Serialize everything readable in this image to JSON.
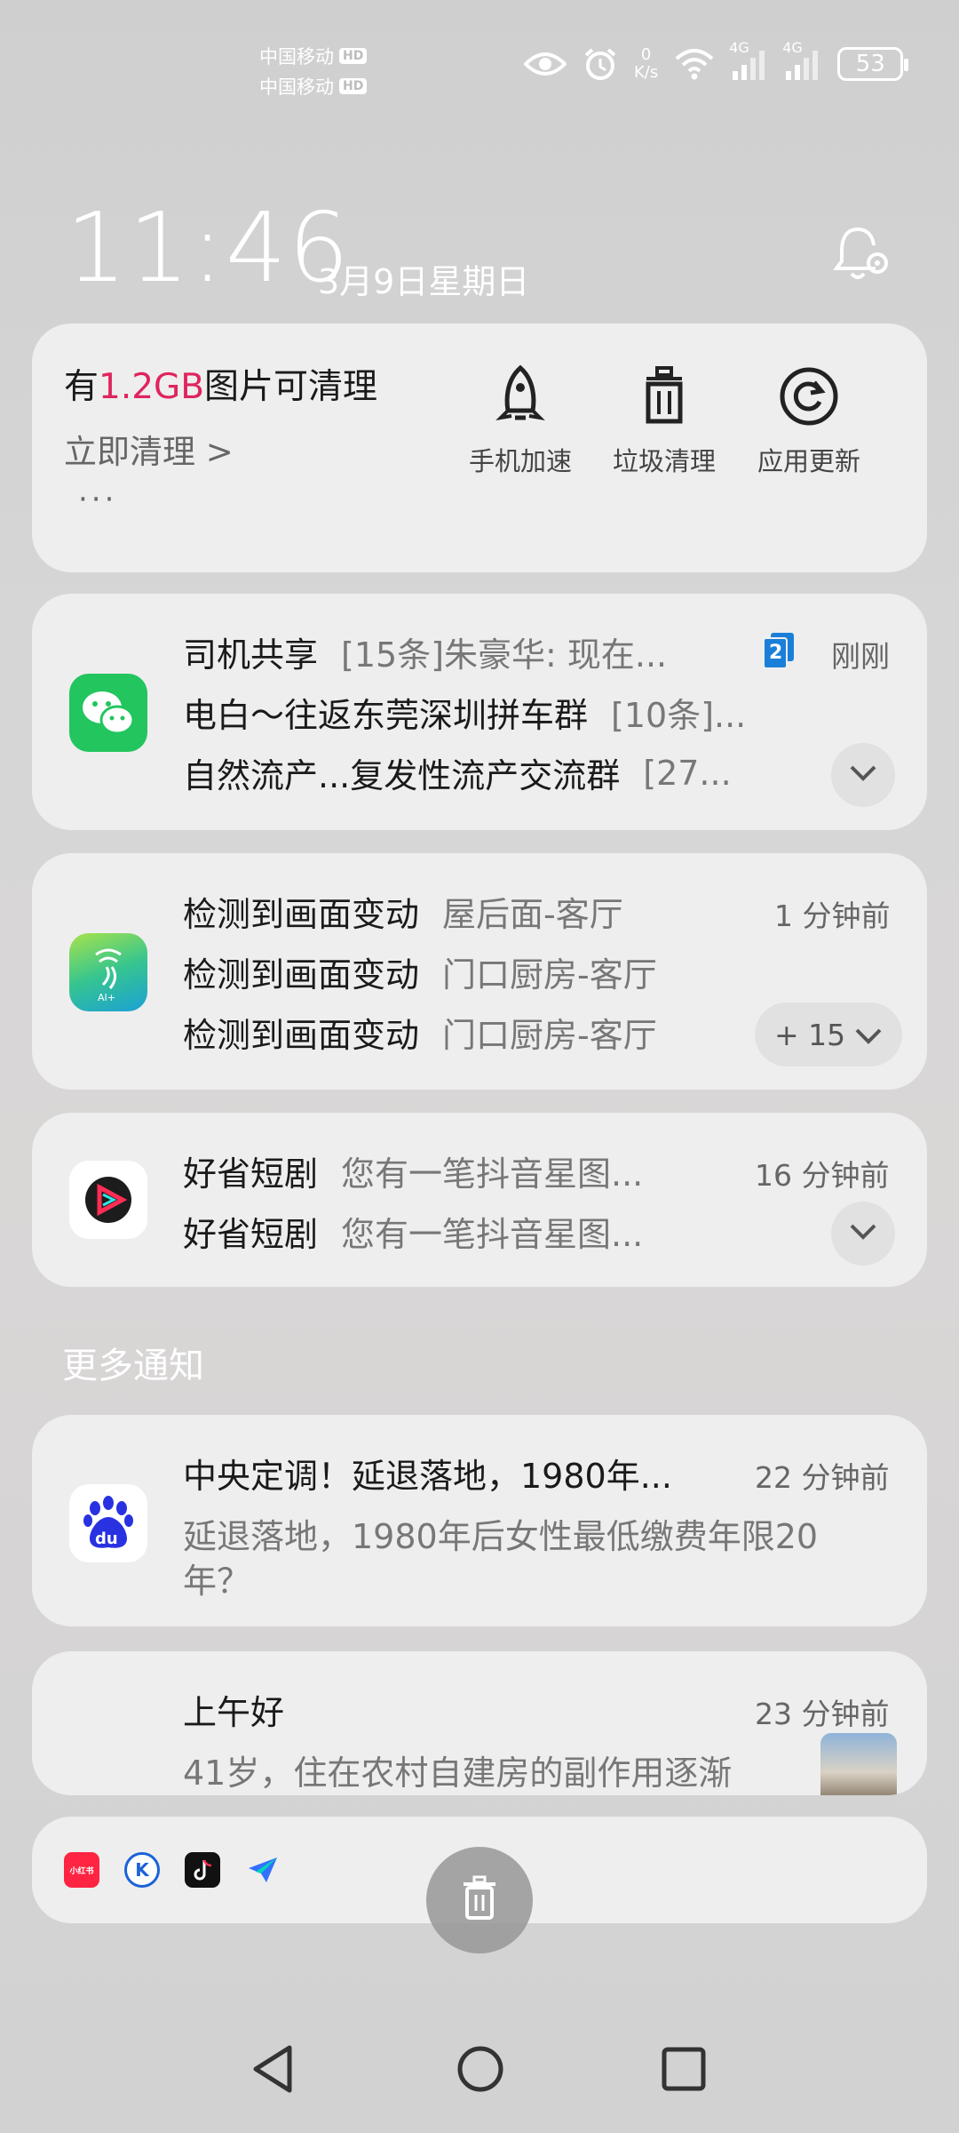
{
  "status_bar": {
    "carrier1": "中国移动",
    "carrier2": "中国移动",
    "hd_badge": "HD",
    "net_speed_value": "0",
    "net_speed_unit": "K/s",
    "signal1_type": "4G",
    "signal2_type": "4G",
    "battery": "53"
  },
  "lockscreen": {
    "time": "11:46",
    "date": "3月9日星期日"
  },
  "cleaner_card": {
    "prefix": "有",
    "size": "1.2GB",
    "suffix": "图片可清理",
    "action": "立即清理 >",
    "more": "···",
    "accent_color": "#e0245e",
    "tools": [
      {
        "label": "手机加速",
        "icon": "rocket-icon"
      },
      {
        "label": "垃圾清理",
        "icon": "trash-icon"
      },
      {
        "label": "应用更新",
        "icon": "refresh-icon"
      }
    ]
  },
  "notifications": [
    {
      "app_icon": "wechat-icon",
      "time": "刚刚",
      "badge": "2",
      "lines": [
        {
          "title": "司机共享",
          "text": "[15条]朱豪华: 现在..."
        },
        {
          "title": "电白～往返东莞深圳拼车群",
          "text": "[10条]..."
        },
        {
          "title": "自然流产...复发性流产交流群",
          "text": "[27..."
        }
      ]
    },
    {
      "app_icon": "camera-ai-icon",
      "time": "1 分钟前",
      "more_count": "+ 15",
      "lines": [
        {
          "title": "检测到画面变动",
          "text": "屋后面-客厅"
        },
        {
          "title": "检测到画面变动",
          "text": "门口厨房-客厅"
        },
        {
          "title": "检测到画面变动",
          "text": "门口厨房-客厅"
        }
      ]
    },
    {
      "app_icon": "video-play-icon",
      "time": "16 分钟前",
      "lines": [
        {
          "title": "好省短剧",
          "text": "您有一笔抖音星图..."
        },
        {
          "title": "好省短剧",
          "text": "您有一笔抖音星图..."
        }
      ]
    }
  ],
  "more_section": {
    "label": "更多通知",
    "items": [
      {
        "app_icon": "baidu-icon",
        "title": "中央定调！延退落地，1980年...",
        "time": "22 分钟前",
        "body1": "延退落地，1980年后女性最低缴费年限20",
        "body2": "年？"
      },
      {
        "title": "上午好",
        "time": "23 分钟前",
        "body1": "41岁，住在农村自建房的副作用逐渐"
      }
    ]
  },
  "dock": {
    "apps": [
      {
        "label": "小红书",
        "color": "#ff2442"
      },
      {
        "label": "K",
        "color": "#1a62d8"
      },
      {
        "label": "douyin-icon",
        "color": "#111111"
      },
      {
        "label": "feishu-icon",
        "color": "#3370ff"
      }
    ]
  }
}
